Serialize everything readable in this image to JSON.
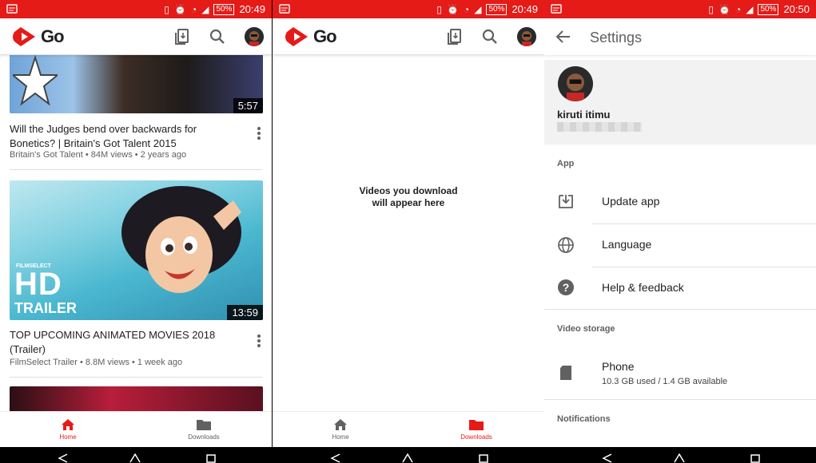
{
  "status_bar": [
    {
      "battery": "50%",
      "time": "20:49"
    },
    {
      "battery": "50%",
      "time": "20:49"
    },
    {
      "battery": "50%",
      "time": "20:50"
    }
  ],
  "app": {
    "logo_text": "Go",
    "brand_color": "#e51b17"
  },
  "icons": {
    "downloads_header": "downloads-icon",
    "search": "search-icon",
    "avatar": "avatar",
    "back": "arrow-back-icon",
    "home": "home-icon",
    "folder": "folder-icon"
  },
  "home_feed": {
    "videos": [
      {
        "duration": "5:57",
        "title": "Will the Judges bend over backwards for Bonetics? | Britain's Got Talent 2015",
        "meta": "Britain's Got Talent • 84M views • 2 years ago"
      },
      {
        "duration": "13:59",
        "thumb_text_small": "FILMSELECT",
        "thumb_text_big": "HD",
        "thumb_text_trailer": "TRAILER",
        "title": "TOP UPCOMING ANIMATED MOVIES 2018 (Trailer)",
        "meta": "FilmSelect Trailer • 8.8M views • 1 week ago"
      }
    ]
  },
  "bottom_nav": {
    "home": "Home",
    "downloads": "Downloads"
  },
  "downloads": {
    "empty_line1": "Videos you download",
    "empty_line2": "will appear here"
  },
  "settings": {
    "title": "Settings",
    "profile_name": "kiruti itimu",
    "section_app": "App",
    "update_app": "Update app",
    "language": "Language",
    "help": "Help & feedback",
    "section_storage": "Video storage",
    "phone": "Phone",
    "phone_usage": "10.3 GB used / 1.4 GB available",
    "section_notifications": "Notifications"
  }
}
